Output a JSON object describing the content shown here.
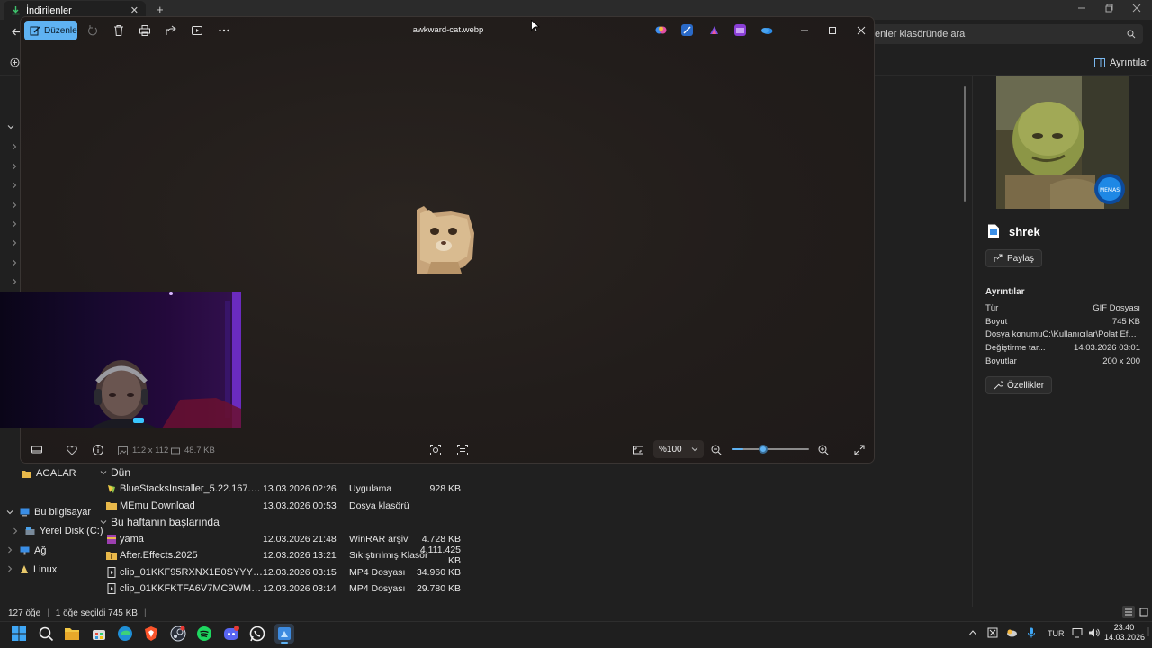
{
  "explorer": {
    "tab_title": "İndirilenler",
    "tab_close": "✕",
    "new_tab": "+",
    "search_placeholder": "enler klasöründe ara",
    "details_button": "Ayrıntılar",
    "nav": {
      "agalar": "AGALAR",
      "bu_bilgisayar": "Bu bilgisayar",
      "yerel_disk": "Yerel Disk (C:)",
      "ag": "Ağ",
      "linux": "Linux"
    },
    "groups": [
      {
        "label": "Dün",
        "rows": [
          {
            "name": "BlueStacksInstaller_5.22.167.1006_native_...",
            "date": "13.03.2026 02:26",
            "type": "Uygulama",
            "size": "928 KB",
            "icon": "bluestacks-icon"
          },
          {
            "name": "MEmu Download",
            "date": "13.03.2026 00:53",
            "type": "Dosya klasörü",
            "size": "",
            "icon": "folder-icon"
          }
        ]
      },
      {
        "label": "Bu haftanın başlarında",
        "rows": [
          {
            "name": "yama",
            "date": "12.03.2026 21:48",
            "type": "WinRAR arşivi",
            "size": "4.728 KB",
            "icon": "winrar-icon"
          },
          {
            "name": "After.Effects.2025",
            "date": "12.03.2026 13:21",
            "type": "Sıkıştırılmış Klasör",
            "size": "4.111.425 KB",
            "icon": "zip-folder-icon"
          },
          {
            "name": "clip_01KKF95RXNX1E0SYYYYXGAW14A",
            "date": "12.03.2026 03:15",
            "type": "MP4 Dosyası",
            "size": "34.960 KB",
            "icon": "video-file-icon"
          },
          {
            "name": "clip_01KKFKTFA6V7MC9WMTK54AXKRW",
            "date": "12.03.2026 03:14",
            "type": "MP4 Dosyası",
            "size": "29.780 KB",
            "icon": "video-file-icon"
          }
        ]
      }
    ],
    "status": {
      "count": "127 öğe",
      "selected": "1 öğe seçildi  745 KB"
    }
  },
  "details_pane": {
    "filename": "shrek",
    "share_label": "Paylaş",
    "heading": "Ayrıntılar",
    "properties": [
      {
        "label": "Tür",
        "value": "GIF Dosyası"
      },
      {
        "label": "Boyut",
        "value": "745 KB"
      },
      {
        "label": "Dosya konumu",
        "value": "C:\\Kullanıcılar\\Polat Efe\\İndiril..."
      },
      {
        "label": "Değiştirme tar...",
        "value": "14.03.2026 03:01"
      },
      {
        "label": "Boyutlar",
        "value": "200 x 200"
      }
    ],
    "properties_button": "Özellikler"
  },
  "photos": {
    "edit_label": "Düzenle",
    "title": "awkward-cat.webp",
    "dimensions": "112 x 112",
    "file_size": "48.7 KB",
    "zoom_label": "%100",
    "zoom_level": 0.15
  },
  "taskbar": {
    "lang": "TUR",
    "time": "23:40",
    "date": "14.03.2026"
  },
  "colors": {
    "accent": "#5fb2f2",
    "viewer_bg": "#221e1c",
    "explorer_bg": "#202020"
  }
}
